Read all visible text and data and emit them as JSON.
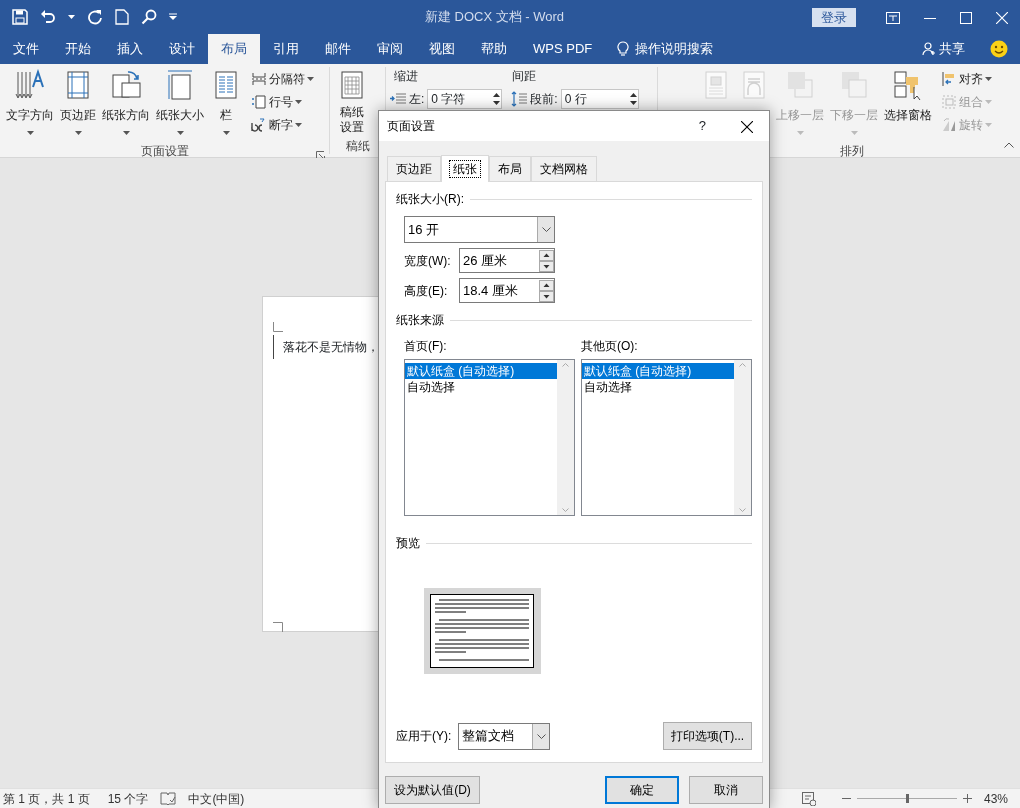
{
  "title_bar": {
    "title": "新建 DOCX 文档  -  Word",
    "sign_in": "登录"
  },
  "ribbon_tabs": [
    {
      "label": "文件",
      "selected": false
    },
    {
      "label": "开始",
      "selected": false
    },
    {
      "label": "插入",
      "selected": false
    },
    {
      "label": "设计",
      "selected": false
    },
    {
      "label": "布局",
      "selected": true
    },
    {
      "label": "引用",
      "selected": false
    },
    {
      "label": "邮件",
      "selected": false
    },
    {
      "label": "审阅",
      "selected": false
    },
    {
      "label": "视图",
      "selected": false
    },
    {
      "label": "帮助",
      "selected": false
    },
    {
      "label": "WPS PDF",
      "selected": false
    }
  ],
  "tell_me": "操作说明搜索",
  "share": "共享",
  "ribbon_groups": [
    {
      "kind": "buttons",
      "label": "页面设置",
      "launcher": true,
      "items": [
        {
          "kind": "large",
          "label": "文字方向",
          "dropdown": true,
          "disabled": false
        },
        {
          "kind": "large",
          "label": "页边距",
          "dropdown": true,
          "disabled": false
        },
        {
          "kind": "large",
          "label": "纸张方向",
          "dropdown": true,
          "disabled": false
        },
        {
          "kind": "large",
          "label": "纸张大小",
          "dropdown": true,
          "disabled": false
        },
        {
          "kind": "large",
          "label": "栏",
          "dropdown": true,
          "disabled": false
        },
        {
          "kind": "small",
          "label": "分隔符",
          "dropdown": true,
          "disabled": false
        },
        {
          "kind": "small",
          "label": "行号",
          "dropdown": true,
          "disabled": false
        },
        {
          "kind": "small",
          "label": "断字",
          "dropdown": true,
          "disabled": false
        }
      ]
    },
    {
      "kind": "buttons",
      "label": "稿纸",
      "launcher": false,
      "items": [
        {
          "kind": "large",
          "label": "稿纸设置",
          "dropdown": false,
          "disabled": false
        }
      ]
    },
    {
      "kind": "paragraph",
      "indent_heading": "缩进",
      "spacing_heading": "间距",
      "indent_left": {
        "label": "左:",
        "value": "0 字符"
      },
      "spacing_before": {
        "label": "段前:",
        "value": "0 行"
      }
    },
    {
      "kind": "buttons",
      "label": "排列",
      "launcher": false,
      "items": [
        {
          "kind": "large",
          "dropdown": false,
          "disabled": true
        },
        {
          "kind": "large",
          "dropdown": false,
          "disabled": true
        },
        {
          "kind": "large",
          "label": "上移一层",
          "dropdown": true,
          "disabled": true
        },
        {
          "kind": "large",
          "label": "下移一层",
          "dropdown": true,
          "disabled": true
        },
        {
          "kind": "large",
          "label": "选择窗格",
          "dropdown": false,
          "disabled": false
        },
        {
          "kind": "small",
          "label": "对齐",
          "dropdown": true,
          "disabled": false
        },
        {
          "kind": "small",
          "label": "组合",
          "dropdown": true,
          "disabled": true
        },
        {
          "kind": "small",
          "label": "旋转",
          "dropdown": true,
          "disabled": true
        }
      ]
    }
  ],
  "document": {
    "text": "落花不是无情物，"
  },
  "status_bar": {
    "page": "第 1 页，共 1 页",
    "words": "15 个字",
    "language": "中文(中国)",
    "zoom": "43%",
    "zoom_slider": {
      "level": 0.5
    }
  },
  "dialog": {
    "title": "页面设置",
    "help": "?",
    "tabs": [
      {
        "label": "页边距",
        "selected": false
      },
      {
        "label": "纸张",
        "selected": true
      },
      {
        "label": "布局",
        "selected": false
      },
      {
        "label": "文档网格",
        "selected": false
      }
    ],
    "paper_size": {
      "heading": "纸张大小(R):",
      "value": "16 开",
      "width_label": "宽度(W):",
      "width_value": "26 厘米",
      "height_label": "高度(E):",
      "height_value": "18.4 厘米"
    },
    "paper_source": {
      "heading": "纸张来源",
      "first_page": {
        "label": "首页(F):",
        "options": [
          {
            "text": "默认纸盒 (自动选择)",
            "selected": true
          },
          {
            "text": "自动选择",
            "selected": false
          }
        ]
      },
      "other_pages": {
        "label": "其他页(O):",
        "options": [
          {
            "text": "默认纸盒 (自动选择)",
            "selected": true
          },
          {
            "text": "自动选择",
            "selected": false
          }
        ]
      }
    },
    "preview": {
      "heading": "预览"
    },
    "apply_to": {
      "label": "应用于(Y):",
      "value": "整篇文档"
    },
    "print_options": "打印选项(T)...",
    "set_default": "设为默认值(D)",
    "ok": "确定",
    "cancel": "取消"
  }
}
